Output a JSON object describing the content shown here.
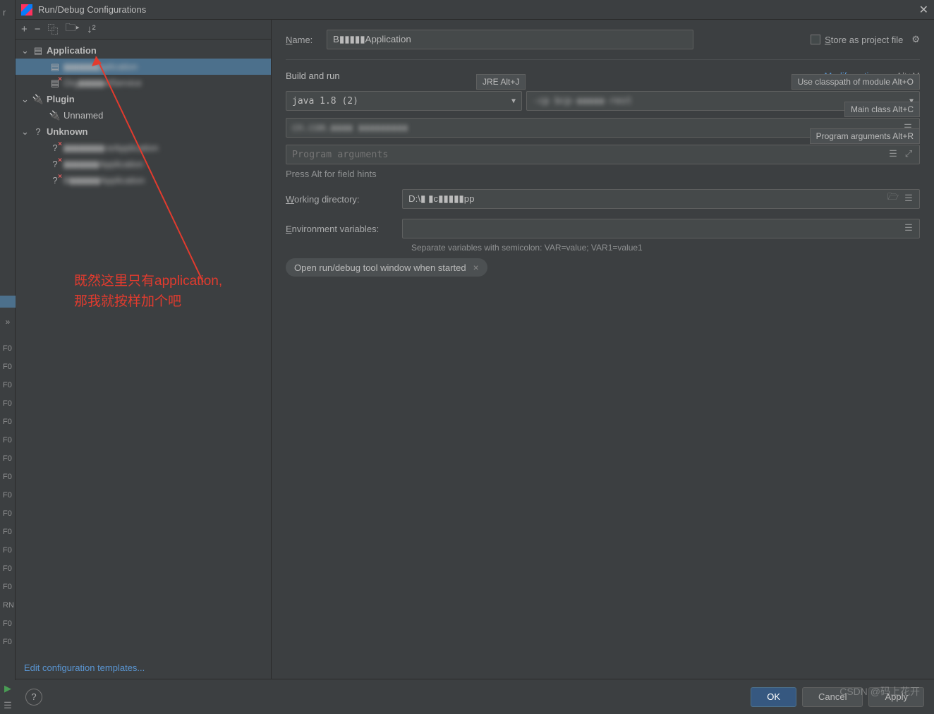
{
  "dialog": {
    "title": "Run/Debug Configurations"
  },
  "underlay": {
    "r": "r",
    "items": [
      "F0",
      "F0",
      "F0",
      "F0",
      "F0",
      "F0",
      "F0",
      "F0",
      "F0",
      "F0",
      "F0",
      "F0",
      "F0",
      "F0",
      "RN",
      "F0",
      "F0"
    ]
  },
  "toolbar": {
    "add": "+",
    "remove": "−",
    "copy": "⿻",
    "folder": "📁",
    "sort": "↓²"
  },
  "tree": {
    "application": "Application",
    "app_items": [
      {
        "name": "▮▮▮▮▮▮▮pplication",
        "selected": true,
        "err": false
      },
      {
        "name": "Org▮▮▮▮▮elService",
        "selected": false,
        "err": true
      }
    ],
    "plugin": "Plugin",
    "plugin_items": [
      {
        "name": "Unnamed"
      }
    ],
    "unknown": "Unknown",
    "unknown_items": [
      {
        "name": "▮▮▮▮▮▮▮▮ceApplication"
      },
      {
        "name": "▮▮▮▮▮▮▮Application"
      },
      {
        "name": "B▮▮▮▮▮▮Application"
      }
    ]
  },
  "edit_templates": "Edit configuration templates...",
  "form": {
    "name_label": "Name:",
    "name_value": "B▮▮▮▮▮Application",
    "store": "Store as project file",
    "build_run": "Build and run",
    "modify": "Modify options",
    "modify_sc": "Alt+M",
    "jre_hint": "JRE Alt+J",
    "classpath_hint": "Use classpath of module Alt+O",
    "java": "java 1.8 (2)",
    "cp": "-cp bcp-▮▮▮▮▮-rest",
    "mainclass_hint": "Main class Alt+C",
    "mainclass": "cn.com.▮▮▮▮ ▮▮▮▮▮▮▮▮▮",
    "progargs_hint": "Program arguments Alt+R",
    "progargs_ph": "Program arguments",
    "althint": "Press Alt for field hints",
    "wd_label": "Working directory:",
    "wd_value": "D:\\▮ ▮c▮▮▮▮▮pp",
    "env_label": "Environment variables:",
    "env_hint": "Separate variables with semicolon: VAR=value; VAR1=value1",
    "tag": "Open run/debug tool window when started"
  },
  "buttons": {
    "ok": "OK",
    "cancel": "Cancel",
    "apply": "Apply"
  },
  "annotation": {
    "l1": "既然这里只有application,",
    "l2": "那我就按样加个吧"
  },
  "watermark": "CSDN @码上花开"
}
